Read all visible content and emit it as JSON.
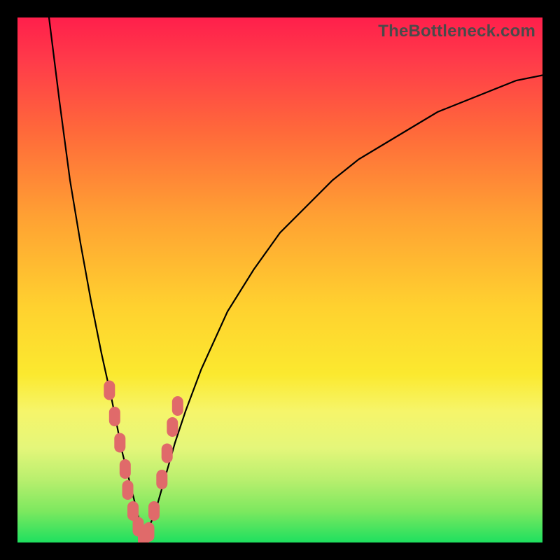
{
  "watermark": "TheBottleneck.com",
  "colors": {
    "marker": "#e06a6a",
    "curve": "#000000",
    "frame": "#000000"
  },
  "chart_data": {
    "type": "line",
    "title": "",
    "xlabel": "",
    "ylabel": "",
    "xlim": [
      0,
      100
    ],
    "ylim": [
      0,
      100
    ],
    "grid": false,
    "legend": false,
    "notes": "Axes are unlabeled. x is interpreted as horizontal position across the plot (0=left, 100=right). y is interpreted as height within the gradient plot area (0=bottom, 100=top). The two black curves form a V shape with a shared trough near x≈24. Pink markers sit along the lower interior walls of the V.",
    "series": [
      {
        "name": "left-curve",
        "x": [
          6,
          8,
          10,
          12,
          14,
          16,
          18,
          19,
          20,
          21,
          22,
          23,
          24
        ],
        "y": [
          100,
          84,
          69,
          57,
          46,
          36,
          27,
          22,
          17,
          13,
          9,
          5,
          1
        ]
      },
      {
        "name": "right-curve",
        "x": [
          24,
          26,
          28,
          30,
          32,
          35,
          40,
          45,
          50,
          55,
          60,
          65,
          70,
          75,
          80,
          85,
          90,
          95,
          100
        ],
        "y": [
          1,
          5,
          12,
          19,
          25,
          33,
          44,
          52,
          59,
          64,
          69,
          73,
          76,
          79,
          82,
          84,
          86,
          88,
          89
        ]
      },
      {
        "name": "markers-left",
        "type": "scatter",
        "x": [
          17.5,
          18.5,
          19.5,
          20.5,
          21.0,
          22.0,
          23.0,
          24.0
        ],
        "y": [
          29,
          24,
          19,
          14,
          10,
          6,
          3,
          1
        ],
        "shape": "rounded-rect"
      },
      {
        "name": "markers-right",
        "type": "scatter",
        "x": [
          25.0,
          26.0,
          27.5,
          28.5,
          29.5,
          30.5
        ],
        "y": [
          2,
          6,
          12,
          17,
          22,
          26
        ],
        "shape": "rounded-rect"
      }
    ]
  }
}
